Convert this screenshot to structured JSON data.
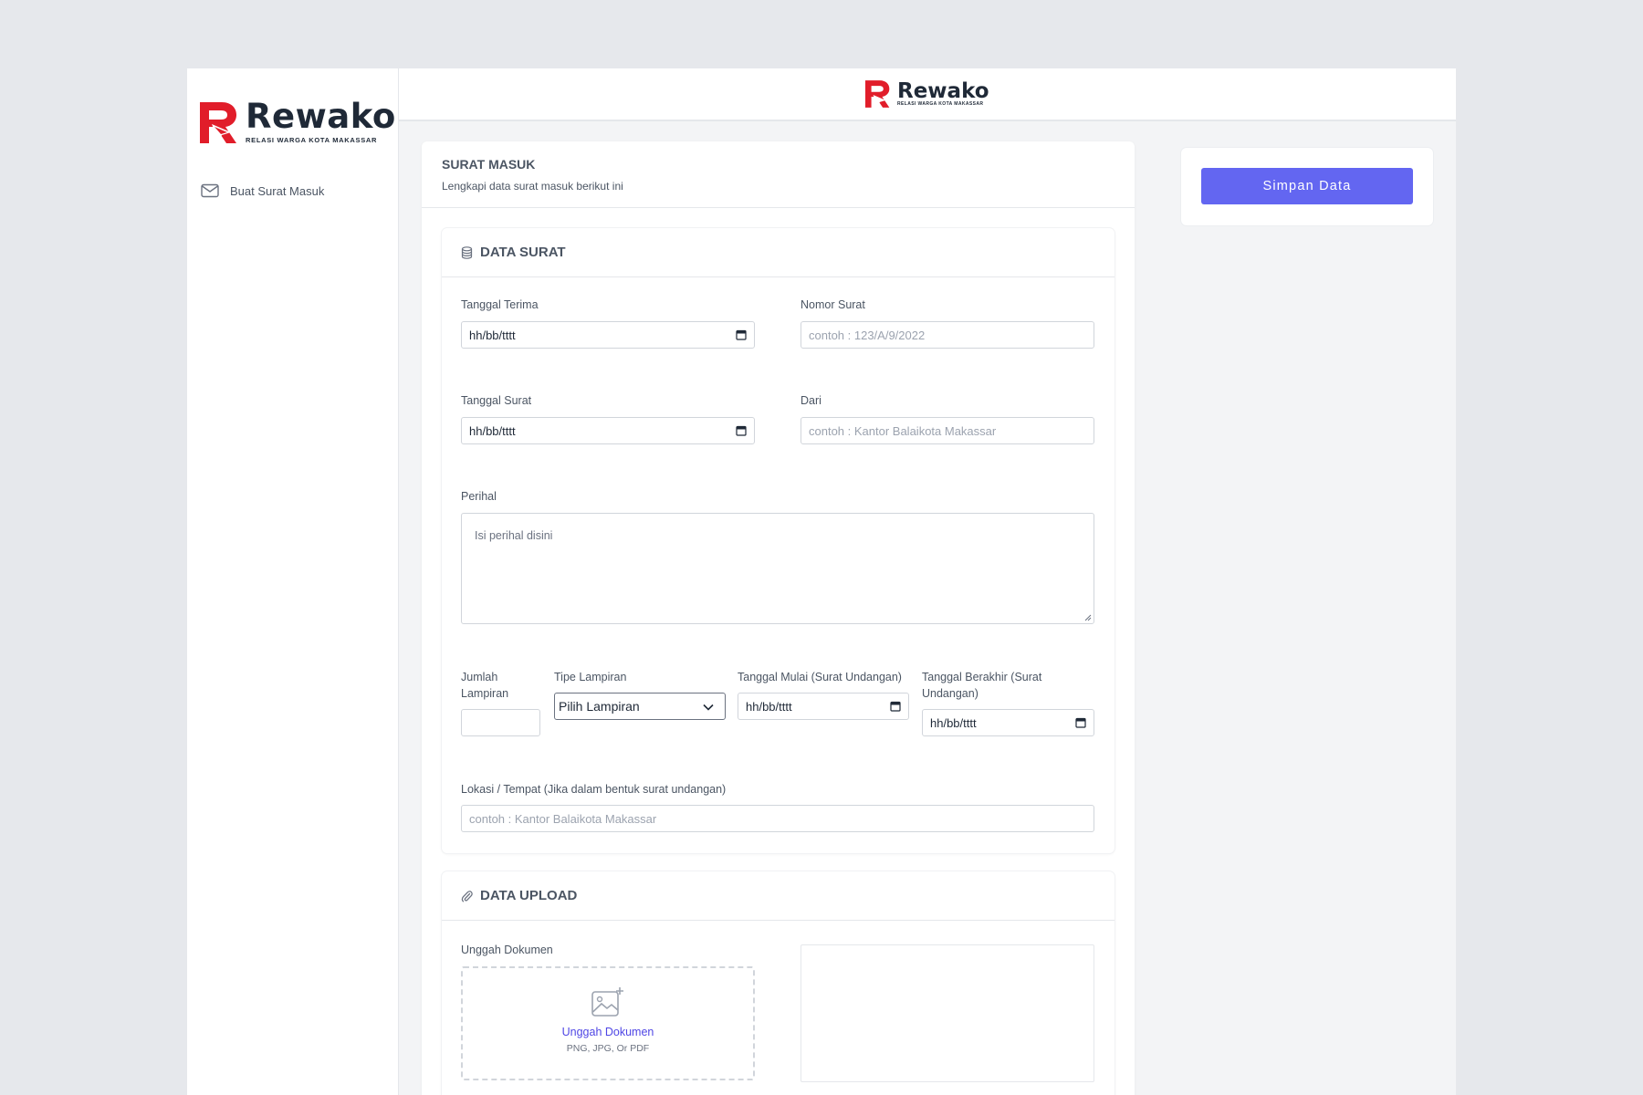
{
  "brand": {
    "name": "Rewako",
    "tagline": "RELASI WARGA KOTA MAKASSAR",
    "accent_color": "#e11d2a"
  },
  "sidebar": {
    "items": [
      {
        "label": "Buat Surat Masuk",
        "icon": "mail-icon"
      }
    ]
  },
  "page": {
    "title": "SURAT MASUK",
    "subtitle": "Lengkapi data surat masuk berikut ini"
  },
  "data_surat": {
    "title": "DATA SURAT",
    "icon": "database-icon",
    "tanggal_terima": {
      "label": "Tanggal Terima",
      "value": "hh/bb/tttt"
    },
    "nomor_surat": {
      "label": "Nomor Surat",
      "placeholder": "contoh : 123/A/9/2022"
    },
    "tanggal_surat": {
      "label": "Tanggal Surat",
      "value": "hh/bb/tttt"
    },
    "dari": {
      "label": "Dari",
      "placeholder": "contoh : Kantor Balaikota Makassar"
    },
    "perihal": {
      "label": "Perihal",
      "placeholder": "Isi perihal disini"
    },
    "jumlah_lampiran": {
      "label_line1": "Jumlah",
      "label_line2": "Lampiran",
      "value": ""
    },
    "tipe_lampiran": {
      "label": "Tipe Lampiran",
      "selected": "Pilih Lampiran"
    },
    "tanggal_mulai": {
      "label": "Tanggal Mulai (Surat Undangan)",
      "value": "hh/bb/tttt"
    },
    "tanggal_berakhir": {
      "label_line1": "Tanggal Berakhir (Surat",
      "label_line2": "Undangan)",
      "value": "hh/bb/tttt"
    },
    "lokasi": {
      "label": "Lokasi / Tempat (Jika dalam bentuk surat undangan)",
      "placeholder": "contoh : Kantor Balaikota Makassar"
    }
  },
  "data_upload": {
    "title": "DATA UPLOAD",
    "icon": "paperclip-icon",
    "label": "Unggah Dokumen",
    "link": "Unggah Dokumen",
    "hint": "PNG, JPG, Or PDF"
  },
  "actions": {
    "save_label": "Simpan Data",
    "save_color": "#6366f1"
  }
}
